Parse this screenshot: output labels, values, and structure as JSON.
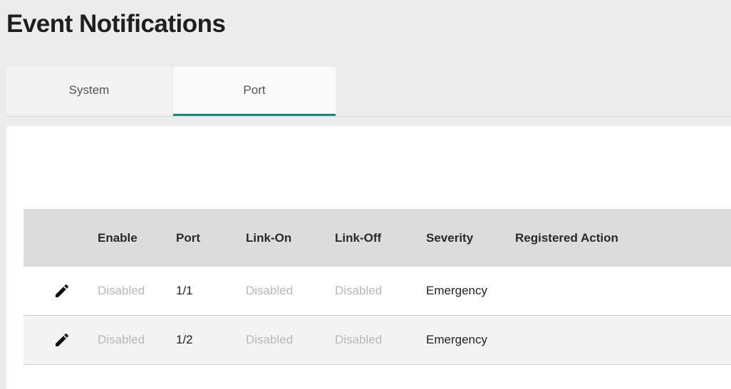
{
  "page": {
    "title": "Event Notifications"
  },
  "tabs": [
    {
      "label": "System",
      "active": false
    },
    {
      "label": "Port",
      "active": true
    }
  ],
  "table": {
    "columns": [
      "Enable",
      "Port",
      "Link-On",
      "Link-Off",
      "Severity",
      "Registered Action"
    ],
    "rows": [
      {
        "enable": "Disabled",
        "port": "1/1",
        "link_on": "Disabled",
        "link_off": "Disabled",
        "severity": "Emergency",
        "registered_action": ""
      },
      {
        "enable": "Disabled",
        "port": "1/2",
        "link_on": "Disabled",
        "link_off": "Disabled",
        "severity": "Emergency",
        "registered_action": ""
      }
    ]
  },
  "icons": {
    "edit": "pencil-icon"
  },
  "colors": {
    "accent": "#138a7e",
    "header_bg": "#dcdcdc",
    "muted_text": "#b8b8b8"
  }
}
